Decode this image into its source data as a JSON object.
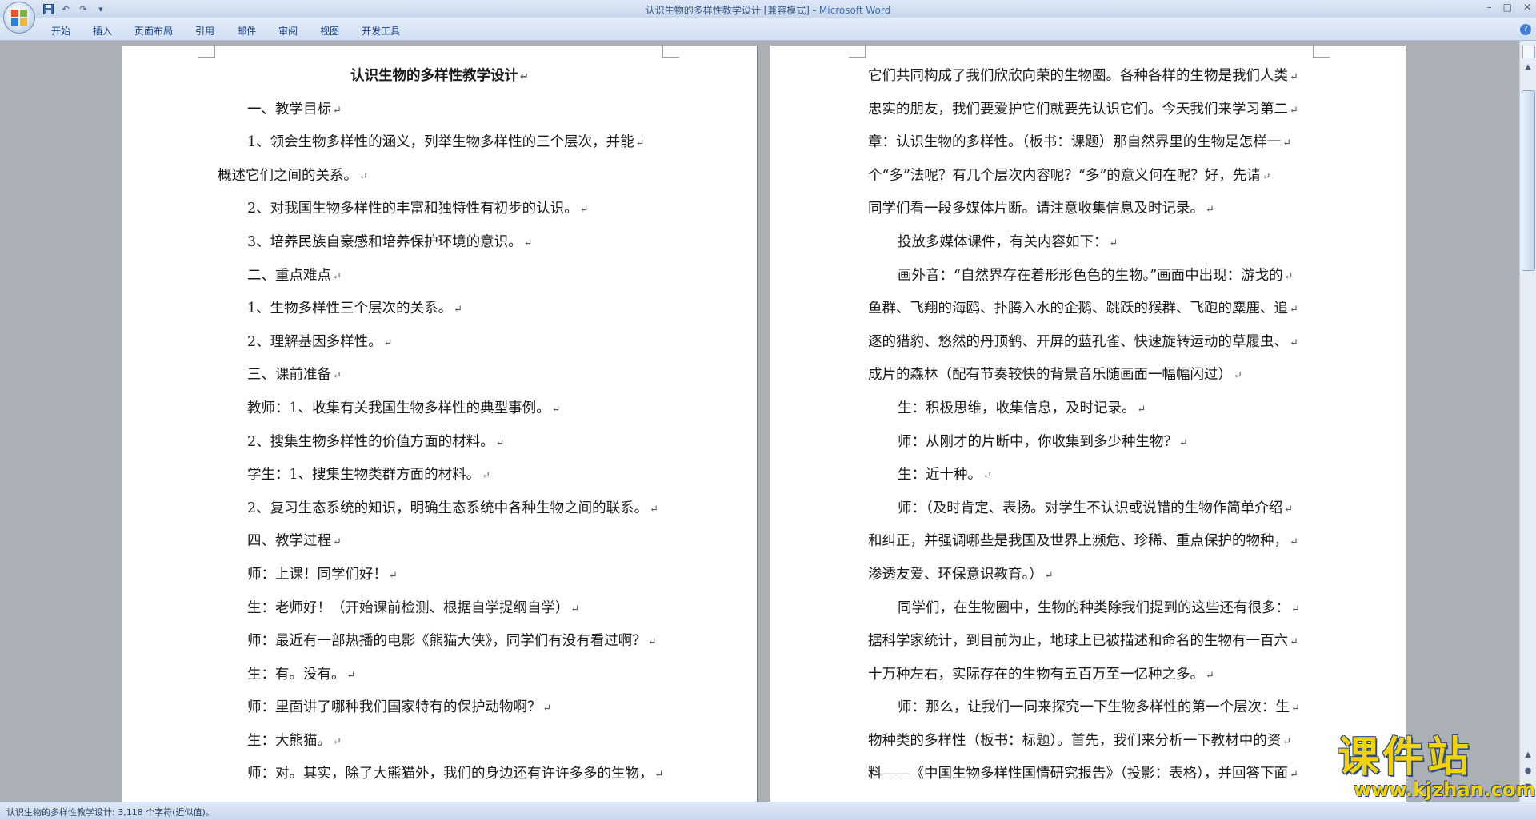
{
  "window": {
    "title_doc": "认识生物的多样性教学设计 [兼容模式] - ",
    "title_app": "Microsoft Word",
    "controls": [
      "–",
      "□",
      "✕"
    ]
  },
  "qat": {
    "save_icon": "save-icon",
    "undo": "↶",
    "redo": "↷",
    "menu": "▾"
  },
  "ribbon_tabs": [
    "开始",
    "插入",
    "页面布局",
    "引用",
    "邮件",
    "审阅",
    "视图",
    "开发工具"
  ],
  "help": "?",
  "left_page": {
    "title": "认识生物的多样性教学设计",
    "lines": [
      {
        "text": "一、教学目标",
        "indent": true
      },
      {
        "text": "1、领会生物多样性的涵义，列举生物多样性的三个层次，并能",
        "indent": true
      },
      {
        "text": "概述它们之间的关系。",
        "indent": false
      },
      {
        "text": "2、对我国生物多样性的丰富和独特性有初步的认识。",
        "indent": true
      },
      {
        "text": "3、培养民族自豪感和培养保护环境的意识。",
        "indent": true
      },
      {
        "text": "二、重点难点",
        "indent": true
      },
      {
        "text": "1、生物多样性三个层次的关系。",
        "indent": true
      },
      {
        "text": "2、理解基因多样性。",
        "indent": true
      },
      {
        "text": "三、课前准备",
        "indent": true
      },
      {
        "text": "教师：1、收集有关我国生物多样性的典型事例。",
        "indent": true
      },
      {
        "text": "2、搜集生物多样性的价值方面的材料。",
        "indent": true
      },
      {
        "text": "学生：1、搜集生物类群方面的材料。",
        "indent": true
      },
      {
        "text": "2、复习生态系统的知识，明确生态系统中各种生物之间的联系。",
        "indent": true
      },
      {
        "text": "四、教学过程",
        "indent": true
      },
      {
        "text": "师：上课！同学们好！",
        "indent": true
      },
      {
        "text": "生：老师好！（开始课前检测、根据自学提纲自学）",
        "indent": true
      },
      {
        "text": "师：最近有一部热播的电影《熊猫大侠》，同学们有没有看过啊？",
        "indent": true
      },
      {
        "text": "生：有。没有。",
        "indent": true
      },
      {
        "text": "师：里面讲了哪种我们国家特有的保护动物啊？",
        "indent": true
      },
      {
        "text": "生：大熊猫。",
        "indent": true
      },
      {
        "text": "师：对。其实，除了大熊猫外，我们的身边还有许许多多的生物，",
        "indent": true
      }
    ]
  },
  "right_page": {
    "lines": [
      {
        "text": "它们共同构成了我们欣欣向荣的生物圈。各种各样的生物是我们人类",
        "indent": false
      },
      {
        "text": "忠实的朋友，我们要爱护它们就要先认识它们。今天我们来学习第二",
        "indent": false
      },
      {
        "text": "章：认识生物的多样性。（板书：课题）那自然界里的生物是怎样一",
        "indent": false
      },
      {
        "text": "个“多”法呢？有几个层次内容呢？“多”的意义何在呢？好，先请",
        "indent": false
      },
      {
        "text": "同学们看一段多媒体片断。请注意收集信息及时记录。",
        "indent": false
      },
      {
        "text": "投放多媒体课件，有关内容如下：",
        "indent": true
      },
      {
        "text": "画外音：“自然界存在着形形色色的生物。”画面中出现：游戈的",
        "indent": true
      },
      {
        "text": "鱼群、飞翔的海鸥、扑腾入水的企鹅、跳跃的猴群、飞跑的麋鹿、追",
        "indent": false
      },
      {
        "text": "逐的猎豹、悠然的丹顶鹤、开屏的蓝孔雀、快速旋转运动的草履虫、",
        "indent": false
      },
      {
        "text": "成片的森林（配有节奏较快的背景音乐随画面一幅幅闪过）",
        "indent": false
      },
      {
        "text": "生：积极思维，收集信息，及时记录。",
        "indent": true
      },
      {
        "text": "师：从刚才的片断中，你收集到多少种生物？",
        "indent": true
      },
      {
        "text": "生：近十种。",
        "indent": true
      },
      {
        "text": "师：（及时肯定、表扬。对学生不认识或说错的生物作简单介绍",
        "indent": true
      },
      {
        "text": "和纠正，并强调哪些是我国及世界上濒危、珍稀、重点保护的物种，",
        "indent": false
      },
      {
        "text": "渗透友爱、环保意识教育。）",
        "indent": false
      },
      {
        "text": "同学们，在生物圈中，生物的种类除我们提到的这些还有很多：",
        "indent": true
      },
      {
        "text": "据科学家统计，到目前为止，地球上已被描述和命名的生物有一百六",
        "indent": false
      },
      {
        "text": "十万种左右，实际存在的生物有五百万至一亿种之多。",
        "indent": false
      },
      {
        "text": "师：那么，让我们一同来探究一下生物多样性的第一个层次：生",
        "indent": true
      },
      {
        "text": "物种类的多样性（板书：标题）。首先，我们来分析一下教材中的资",
        "indent": false
      },
      {
        "text": "料——《中国生物多样性国情研究报告》（投影：表格），并回答下面",
        "indent": false
      }
    ]
  },
  "para_mark": "↵",
  "status": "认识生物的多样性教学设计: 3,118 个字符(近似值)。",
  "watermark": {
    "big": "课件站",
    "small": "www.kjzhan.com"
  }
}
